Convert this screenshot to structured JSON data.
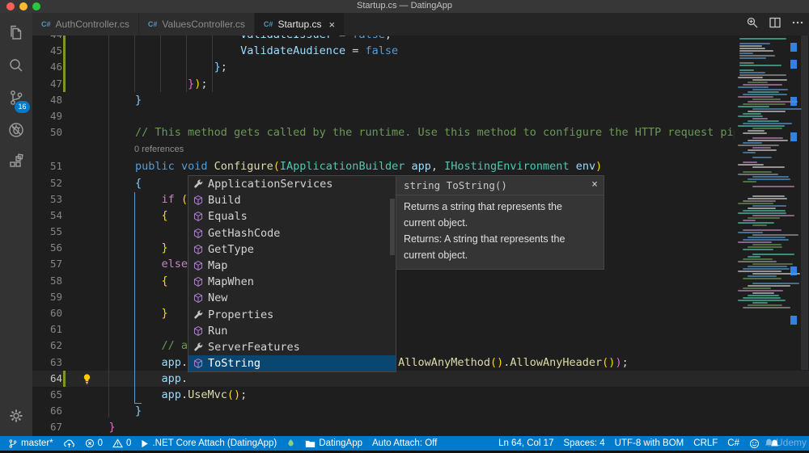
{
  "window": {
    "title": "Startup.cs — DatingApp"
  },
  "tabs": [
    {
      "label": "AuthController.cs",
      "active": false
    },
    {
      "label": "ValuesController.cs",
      "active": false
    },
    {
      "label": "Startup.cs",
      "active": true,
      "close": "×"
    }
  ],
  "editor_actions": [
    {
      "name": "open-changes"
    },
    {
      "name": "split-editor"
    },
    {
      "name": "more-actions"
    }
  ],
  "activity_bar": {
    "items": [
      {
        "name": "explorer"
      },
      {
        "name": "search"
      },
      {
        "name": "source-control",
        "badge": "16"
      },
      {
        "name": "debug"
      },
      {
        "name": "extensions"
      }
    ],
    "bottom": [
      {
        "name": "settings"
      }
    ]
  },
  "code": {
    "codelens": "0 references",
    "lines": [
      {
        "n": 44,
        "modified": true,
        "tokens": [
          [
            "pl",
            "                        "
          ],
          [
            "var",
            "ValidateIssuer"
          ],
          [
            "pl",
            " = "
          ],
          [
            "kw",
            "false"
          ],
          [
            "pl",
            ";"
          ]
        ]
      },
      {
        "n": 45,
        "modified": true,
        "tokens": [
          [
            "pl",
            "                        "
          ],
          [
            "var",
            "ValidateAudience"
          ],
          [
            "pl",
            " = "
          ],
          [
            "kw",
            "false"
          ]
        ]
      },
      {
        "n": 46,
        "modified": true,
        "tokens": [
          [
            "pl",
            "                    "
          ],
          [
            "b3",
            "}"
          ],
          [
            "pl",
            ";"
          ]
        ]
      },
      {
        "n": 47,
        "modified": true,
        "tokens": [
          [
            "pl",
            "                "
          ],
          [
            "b2",
            "}"
          ],
          [
            "b1",
            ")"
          ],
          [
            "pl",
            ";"
          ]
        ]
      },
      {
        "n": 48,
        "tokens": [
          [
            "pl",
            "        "
          ],
          [
            "b3",
            "}"
          ]
        ]
      },
      {
        "n": 49,
        "tokens": []
      },
      {
        "n": 50,
        "tokens": [
          [
            "pl",
            "        "
          ],
          [
            "cm",
            "// This method gets called by the runtime. Use this method to configure the HTTP request pipeline."
          ]
        ]
      },
      {
        "n": 51,
        "codelens_above": true,
        "tokens": [
          [
            "pl",
            "        "
          ],
          [
            "kw",
            "public"
          ],
          [
            "pl",
            " "
          ],
          [
            "kw",
            "void"
          ],
          [
            "pl",
            " "
          ],
          [
            "fn",
            "Configure"
          ],
          [
            "b1",
            "("
          ],
          [
            "type",
            "IApplicationBuilder"
          ],
          [
            "pl",
            " "
          ],
          [
            "var",
            "app"
          ],
          [
            "pl",
            ", "
          ],
          [
            "type",
            "IHostingEnvironment"
          ],
          [
            "pl",
            " "
          ],
          [
            "var",
            "env"
          ],
          [
            "b1",
            ")"
          ]
        ]
      },
      {
        "n": 52,
        "tokens": [
          [
            "pl",
            "        "
          ],
          [
            "b3",
            "{"
          ]
        ]
      },
      {
        "n": 53,
        "tokens": [
          [
            "pl",
            "            "
          ],
          [
            "ctrl",
            "if"
          ],
          [
            "pl",
            " "
          ],
          [
            "b1",
            "("
          ]
        ]
      },
      {
        "n": 54,
        "tokens": [
          [
            "pl",
            "            "
          ],
          [
            "b1",
            "{"
          ]
        ]
      },
      {
        "n": 55,
        "tokens": []
      },
      {
        "n": 56,
        "tokens": [
          [
            "pl",
            "            "
          ],
          [
            "b1",
            "}"
          ]
        ]
      },
      {
        "n": 57,
        "tokens": [
          [
            "pl",
            "            "
          ],
          [
            "ctrl",
            "else"
          ]
        ]
      },
      {
        "n": 58,
        "tokens": [
          [
            "pl",
            "            "
          ],
          [
            "b1",
            "{"
          ]
        ]
      },
      {
        "n": 59,
        "tokens": []
      },
      {
        "n": 60,
        "tokens": [
          [
            "pl",
            "            "
          ],
          [
            "b1",
            "}"
          ]
        ]
      },
      {
        "n": 61,
        "tokens": []
      },
      {
        "n": 62,
        "tokens": [
          [
            "pl",
            "            "
          ],
          [
            "cm",
            "// a"
          ]
        ]
      },
      {
        "n": 63,
        "tokens": [
          [
            "pl",
            "            "
          ],
          [
            "var",
            "app"
          ],
          [
            "pl",
            "."
          ],
          [
            "pl",
            "                                "
          ],
          [
            "fn",
            "AllowAnyMethod"
          ],
          [
            "b1",
            "()"
          ],
          [
            "pl",
            "."
          ],
          [
            "fn",
            "AllowAnyHeader"
          ],
          [
            "b1",
            "()"
          ],
          [
            "b2",
            ")"
          ],
          [
            "pl",
            ";"
          ]
        ]
      },
      {
        "n": 64,
        "current": true,
        "modified": true,
        "lightbulb": true,
        "tokens": [
          [
            "pl",
            "            "
          ],
          [
            "var",
            "app"
          ],
          [
            "pl",
            "."
          ]
        ]
      },
      {
        "n": 65,
        "tokens": [
          [
            "pl",
            "            "
          ],
          [
            "var",
            "app"
          ],
          [
            "pl",
            "."
          ],
          [
            "fn",
            "UseMvc"
          ],
          [
            "b1",
            "()"
          ],
          [
            "pl",
            ";"
          ]
        ]
      },
      {
        "n": 66,
        "tokens": [
          [
            "pl",
            "        "
          ],
          [
            "b3",
            "}"
          ]
        ]
      },
      {
        "n": 67,
        "tokens": [
          [
            "pl",
            "    "
          ],
          [
            "b2",
            "}"
          ]
        ]
      }
    ]
  },
  "suggest": {
    "items": [
      {
        "label": "ApplicationServices",
        "kind": "property"
      },
      {
        "label": "Build",
        "kind": "method"
      },
      {
        "label": "Equals",
        "kind": "method"
      },
      {
        "label": "GetHashCode",
        "kind": "method"
      },
      {
        "label": "GetType",
        "kind": "method"
      },
      {
        "label": "Map",
        "kind": "method"
      },
      {
        "label": "MapWhen",
        "kind": "method"
      },
      {
        "label": "New",
        "kind": "method"
      },
      {
        "label": "Properties",
        "kind": "property"
      },
      {
        "label": "Run",
        "kind": "method"
      },
      {
        "label": "ServerFeatures",
        "kind": "property"
      },
      {
        "label": "ToString",
        "kind": "method",
        "selected": true
      }
    ]
  },
  "docs": {
    "signature": "string ToString()",
    "close": "×",
    "paragraphs": [
      "Returns a string that represents the current object.",
      "Returns: A string that represents the current object."
    ]
  },
  "status_bar": {
    "left": [
      {
        "name": "git-branch",
        "icon": "branch",
        "label": "master*"
      },
      {
        "name": "publish",
        "icon": "cloud-upload",
        "label": ""
      },
      {
        "name": "errors",
        "icon": "error",
        "label": "0"
      },
      {
        "name": "warnings",
        "icon": "warning",
        "label": "0"
      },
      {
        "name": "debug-launch",
        "icon": "play",
        "label": ".NET Core Attach (DatingApp)"
      },
      {
        "name": "flame",
        "icon": "flame",
        "label": ""
      },
      {
        "name": "workspace",
        "icon": "folder",
        "label": "DatingApp"
      },
      {
        "name": "auto-attach",
        "icon": "",
        "label": "Auto Attach: Off"
      }
    ],
    "right": [
      {
        "name": "cursor-position",
        "label": "Ln 64, Col 17"
      },
      {
        "name": "indentation",
        "label": "Spaces: 4"
      },
      {
        "name": "encoding",
        "label": "UTF-8 with BOM"
      },
      {
        "name": "eol",
        "label": "CRLF"
      },
      {
        "name": "language-mode",
        "label": "C#"
      },
      {
        "name": "feedback",
        "icon": "smiley",
        "label": ""
      },
      {
        "name": "notifications",
        "icon": "bell",
        "label": ""
      }
    ]
  },
  "watermark": {
    "text": "Udemy"
  },
  "colors": {
    "accent": "#007acc",
    "modified_gutter": "#7d9726",
    "selection": "#094771"
  }
}
